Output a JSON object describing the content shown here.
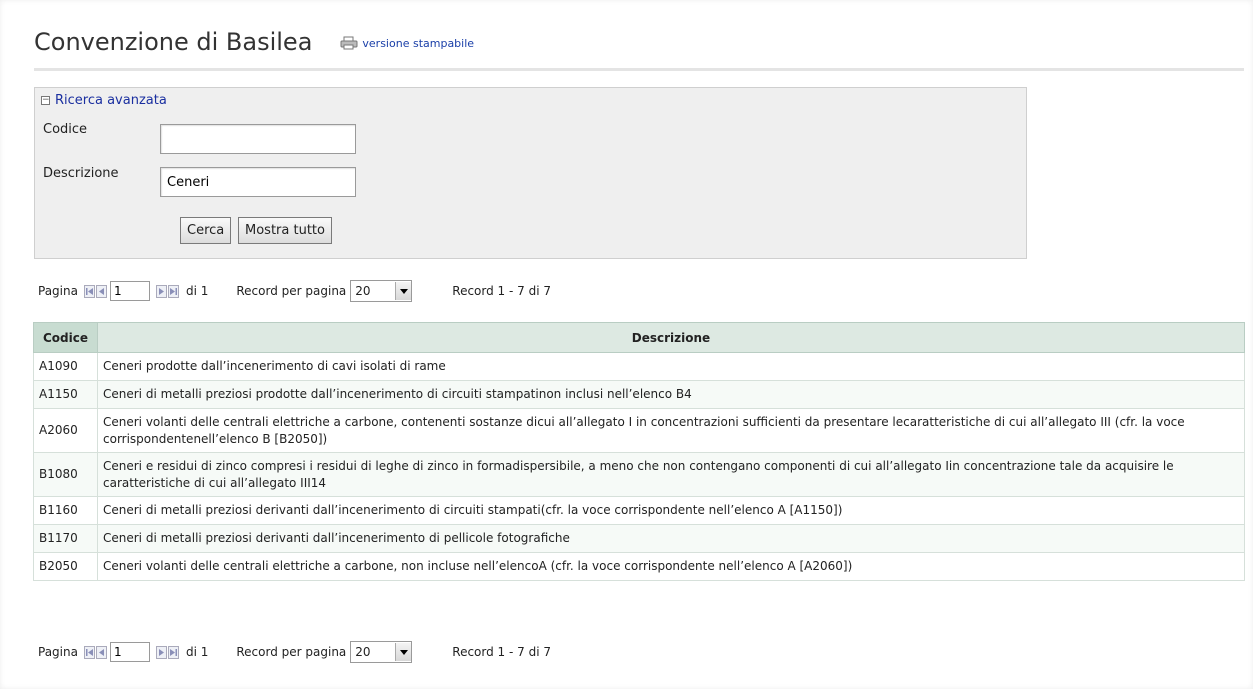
{
  "header": {
    "title": "Convenzione di Basilea",
    "print_link": "versione stampabile",
    "print_icon": "printer-icon"
  },
  "search": {
    "toggle_label": "Ricerca avanzata",
    "toggle_icon": "collapse-minus-icon",
    "code_label": "Codice",
    "code_value": "",
    "description_label": "Descrizione",
    "description_value": "Ceneri",
    "search_button": "Cerca",
    "show_all_button": "Mostra tutto"
  },
  "pager": {
    "page_label": "Pagina",
    "current_page": "1",
    "of_label": "di 1",
    "per_page_label": "Record per pagina",
    "per_page_value": "20",
    "record_info": "Record 1 - 7 di 7"
  },
  "table": {
    "headers": [
      "Codice",
      "Descrizione"
    ],
    "rows": [
      {
        "code": "A1090",
        "description": "Ceneri prodotte dall’incenerimento di cavi isolati di rame"
      },
      {
        "code": "A1150",
        "description": "Ceneri di metalli preziosi prodotte dall’incenerimento di circuiti stampatinon inclusi nell’elenco B4"
      },
      {
        "code": "A2060",
        "description": "Ceneri volanti delle centrali elettriche a carbone, contenenti sostanze dicui all’allegato I in concentrazioni sufficienti da presentare lecaratteristiche di cui all’allegato III (cfr. la voce corrispondentenell’elenco B [B2050])"
      },
      {
        "code": "B1080",
        "description": "Ceneri e residui di zinco compresi i residui di leghe di zinco in formadispersibile, a meno che non contengano componenti di cui all’allegato Iin concentrazione tale da acquisire le caratteristiche di cui all’allegato III14"
      },
      {
        "code": "B1160",
        "description": "Ceneri di metalli preziosi derivanti dall’incenerimento di circuiti stampati(cfr. la voce corrispondente nell’elenco A [A1150])"
      },
      {
        "code": "B1170",
        "description": "Ceneri di metalli preziosi derivanti dall’incenerimento di pellicole fotografiche"
      },
      {
        "code": "B2050",
        "description": "Ceneri volanti delle centrali elettriche a carbone, non incluse nell’elencoA (cfr. la voce corrispondente nell’elenco A [A2060])"
      }
    ]
  }
}
